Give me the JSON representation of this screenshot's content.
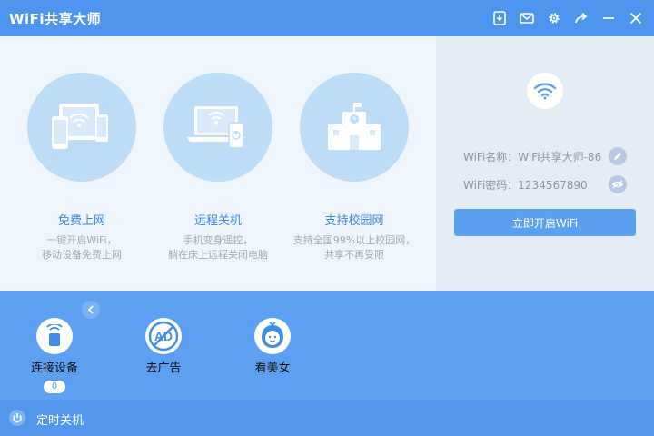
{
  "app": {
    "title": "WiFi共享大师"
  },
  "titlebar": {
    "icons": [
      "download-icon",
      "mail-icon",
      "gear-icon",
      "share-icon",
      "minimize-icon",
      "close-icon"
    ]
  },
  "features": [
    {
      "title": "免费上网",
      "desc_line1": "一键开启WiFi，",
      "desc_line2": "移动设备免费上网",
      "icon": "devices-wifi-icon"
    },
    {
      "title": "远程关机",
      "desc_line1": "手机变身遥控，",
      "desc_line2": "躺在床上远程关闭电脑",
      "icon": "laptop-remote-icon"
    },
    {
      "title": "支持校园网",
      "desc_line1": "支持全国99%以上校园网，",
      "desc_line2": "共享不再受限",
      "icon": "school-building-icon"
    }
  ],
  "wifi_panel": {
    "name_text": "WiFi名称：WiFi共享大师-86",
    "password_text": "WiFi密码：1234567890",
    "start_label": "立即开启WiFi"
  },
  "tools": [
    {
      "label": "连接设备",
      "count": "0",
      "icon": "connected-device-icon"
    },
    {
      "label": "去广告",
      "icon": "ad-block-icon"
    },
    {
      "label": "看美女",
      "icon": "girl-avatar-icon"
    }
  ],
  "footer": {
    "label": "定时关机"
  },
  "colors": {
    "accent": "#4d95ee",
    "feature_circle": "#bcdcf8",
    "feature_title": "#3b86e0",
    "panel_bg": "#e4ecf5",
    "tools_bg": "#5d9ff0"
  }
}
